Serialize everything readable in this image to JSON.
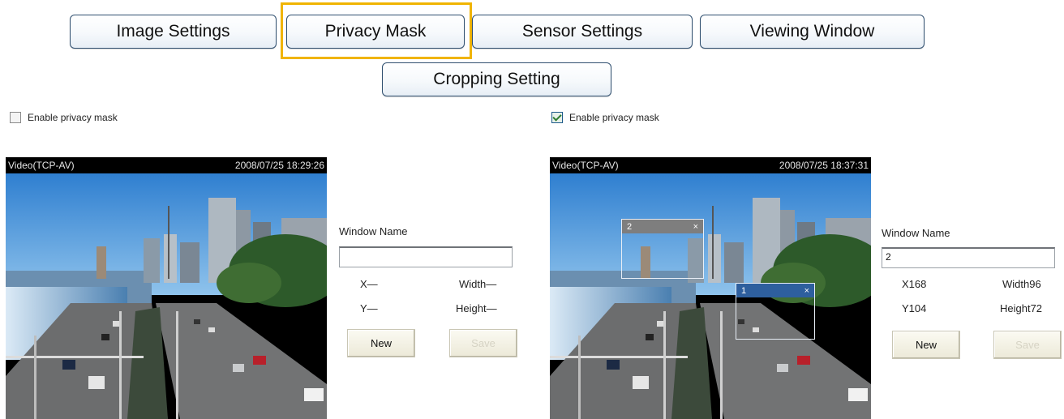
{
  "tabs": {
    "image_settings": "Image Settings",
    "privacy_mask": "Privacy Mask",
    "sensor_settings": "Sensor Settings",
    "viewing_window": "Viewing Window",
    "cropping_setting": "Cropping Setting",
    "highlight_color": "#f0b400"
  },
  "left": {
    "enable_label": "Enable privacy mask",
    "enable_checked": false,
    "video_source": "Video(TCP-AV)",
    "timestamp": "2008/07/25 18:29:26",
    "window_name_label": "Window Name",
    "window_name_value": "",
    "x_text": "X—",
    "y_text": "Y—",
    "width_text": "Width—",
    "height_text": "Height—",
    "new_label": "New",
    "save_label": "Save"
  },
  "right": {
    "enable_label": "Enable privacy mask",
    "enable_checked": true,
    "video_source": "Video(TCP-AV)",
    "timestamp": "2008/07/25 18:37:31",
    "mask_2_label": "2",
    "mask_2_close": "×",
    "mask_1_label": "1",
    "mask_1_close": "×",
    "window_name_label": "Window Name",
    "window_name_value": "2",
    "x_text": "X168",
    "y_text": "Y104",
    "width_text": "Width96",
    "height_text": "Height72",
    "new_label": "New",
    "save_label": "Save"
  }
}
